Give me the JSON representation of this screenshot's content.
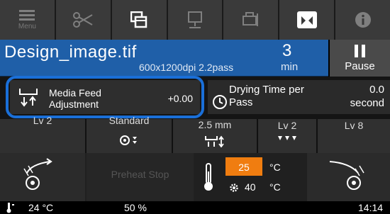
{
  "toolbar": {
    "menu_label": "Menu",
    "icons": [
      "menu-icon",
      "scissors-icon",
      "copy-icon",
      "printhead-icon",
      "printer-maintenance-icon",
      "book-icon",
      "info-icon"
    ]
  },
  "banner": {
    "filename": "Design_image.tif",
    "resolution": "600x1200dpi 2.2pass",
    "remaining_value": "3",
    "remaining_unit": "min",
    "pause_label": "Pause"
  },
  "media_feed": {
    "line1": "Media Feed",
    "line2": "Adjustment",
    "value": "+0.00"
  },
  "drying": {
    "line1": "Drying Time per",
    "line2": "Pass",
    "value": "0.0",
    "unit": "second"
  },
  "settings": {
    "cells": [
      "Lv 2",
      "Standard",
      "2.5 mm",
      "Lv 2",
      "Lv 8"
    ]
  },
  "preheat": {
    "label": "Preheat Stop"
  },
  "temperature": {
    "current": "25",
    "current_unit": "°C",
    "target": "40",
    "target_unit": "°C"
  },
  "status": {
    "ambient": "24 °C",
    "ink": "50 %",
    "time": "14:14"
  },
  "colors": {
    "banner_blue": "#1f5fa8",
    "highlight_blue": "#1a6fd8",
    "heater_orange": "#f07d10"
  }
}
